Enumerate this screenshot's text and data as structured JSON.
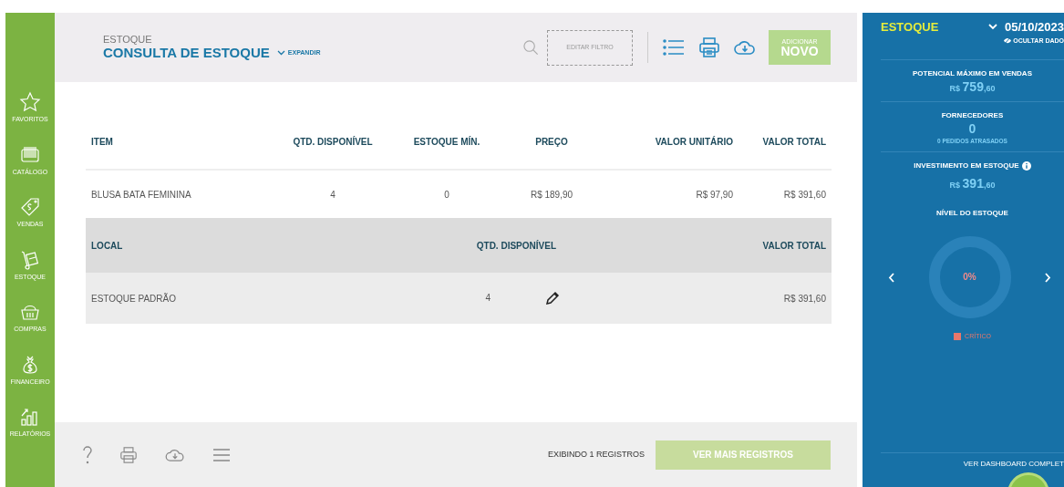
{
  "sidebar": {
    "items": [
      {
        "label": "FAVORITOS"
      },
      {
        "label": "CATÁLOGO"
      },
      {
        "label": "VENDAS"
      },
      {
        "label": "ESTOQUE"
      },
      {
        "label": "COMPRAS"
      },
      {
        "label": "FINANCEIRO"
      },
      {
        "label": "RELATÓRIOS"
      }
    ]
  },
  "header": {
    "breadcrumb": "ESTOQUE",
    "title": "CONSULTA DE ESTOQUE",
    "expand": "EXPANDIR",
    "filter_button": "EDITAR FILTRO",
    "add_button": {
      "line_1": "ADICIONAR",
      "line_2": "NOVO"
    }
  },
  "items_table": {
    "columns": [
      "ITEM",
      "QTD. DISPONÍVEL",
      "ESTOQUE MÍN.",
      "PREÇO",
      "VALOR UNITÁRIO",
      "VALOR TOTAL"
    ],
    "rows": [
      [
        "BLUSA BATA FEMININA",
        "4",
        "0",
        "R$ 189,90",
        "R$ 97,90",
        "R$ 391,60"
      ]
    ]
  },
  "locations_table": {
    "columns": [
      "LOCAL",
      "QTD. DISPONÍVEL",
      "VALOR TOTAL"
    ],
    "rows": [
      {
        "local": "ESTOQUE PADRÃO",
        "quantity": "4",
        "total": "R$ 391,60",
        "editable": true
      }
    ]
  },
  "footer": {
    "count": "EXIBINDO 1 REGISTROS",
    "more_button": "VER MAIS REGISTROS"
  },
  "panel": {
    "title": "ESTOQUE",
    "date": "05/10/2023",
    "hide_link": "OCULTAR DADO",
    "stats": [
      {
        "kind": "money",
        "label": "POTENCIAL MÁXIMO EM VENDAS",
        "prefix": "R$",
        "amount": "759",
        "cents": ",60",
        "info": false
      },
      {
        "kind": "count",
        "label": "FORNECEDORES",
        "value": "0",
        "note": "0 PEDIDOS ATRASADOS",
        "info": false
      },
      {
        "kind": "money",
        "label": "INVESTIMENTO EM ESTOQUE",
        "prefix": "R$",
        "amount": "391",
        "cents": ",60",
        "info": true
      }
    ],
    "stock_level": {
      "label": "NÍVEL DO ESTOQUE",
      "reading": "0%",
      "level": 0,
      "legend": [
        {
          "label": "CRÍTICO",
          "color": "#e8776b"
        }
      ]
    },
    "dashboard_link": "VER DASHBOARD COMPLET"
  }
}
